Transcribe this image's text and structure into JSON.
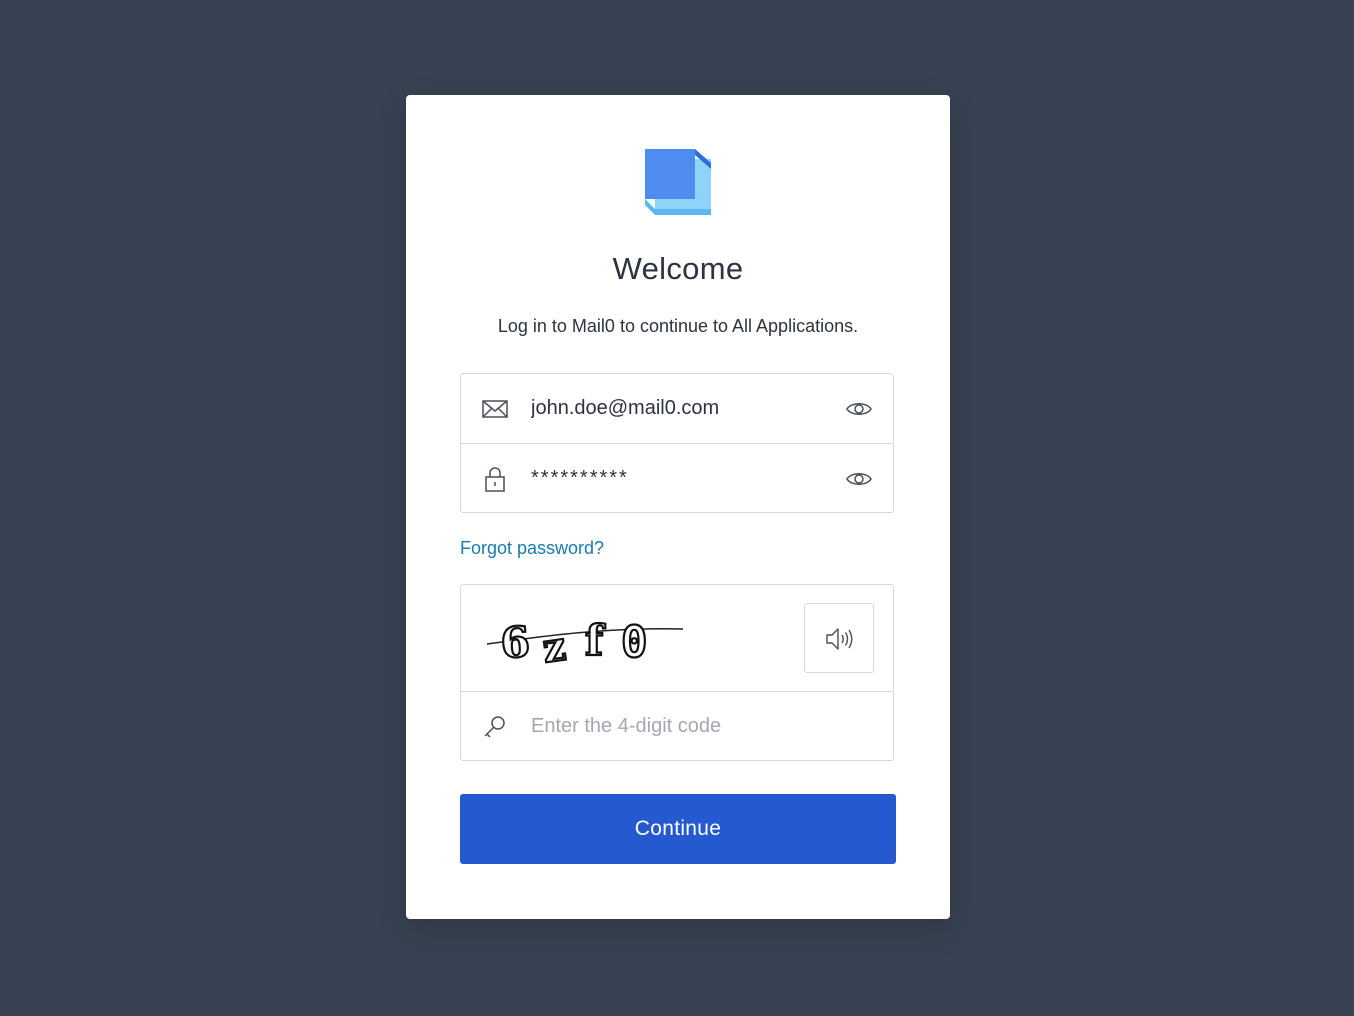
{
  "brand": {
    "logo_icon": "cube-logo-icon",
    "primary_color": "#2559d0",
    "link_color": "#1a7bb0"
  },
  "header": {
    "title": "Welcome",
    "subtitle": "Log in to Mail0 to continue to All Applications."
  },
  "login": {
    "email_value": "john.doe@mail0.com",
    "email_icon": "envelope-icon",
    "password_value": "**********",
    "password_icon": "lock-icon",
    "visibility_icon": "eye-icon"
  },
  "forgot_password_label": "Forgot password?",
  "captcha": {
    "image_text": "6zf0",
    "audio_icon": "speaker-icon",
    "code_placeholder": "Enter the 4-digit code",
    "code_icon": "key-icon"
  },
  "continue_label": "Continue"
}
